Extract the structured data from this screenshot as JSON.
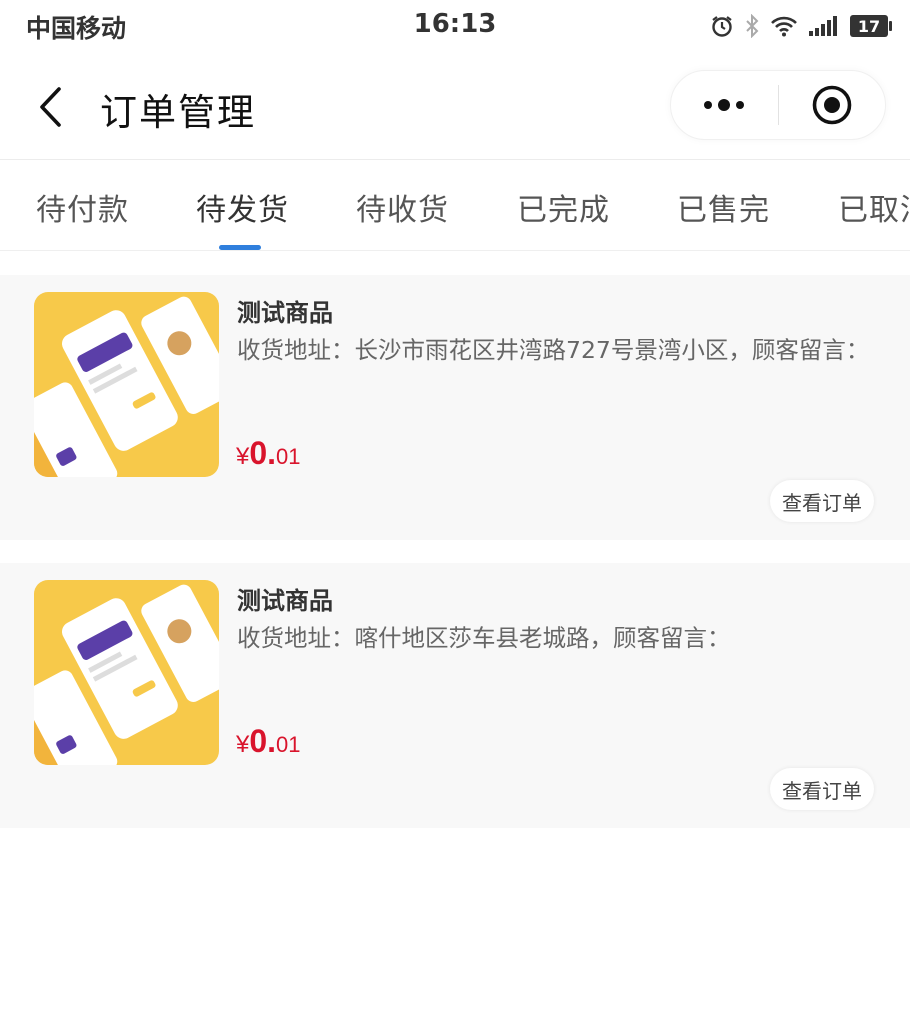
{
  "status_bar": {
    "carrier": "中国移动",
    "time": "16:13",
    "battery": "17"
  },
  "nav": {
    "title": "订单管理"
  },
  "tabs": [
    {
      "label": "待付款",
      "active": false
    },
    {
      "label": "待发货",
      "active": true
    },
    {
      "label": "待收货",
      "active": false
    },
    {
      "label": "已完成",
      "active": false
    },
    {
      "label": "已售完",
      "active": false
    },
    {
      "label": "已取消",
      "active": false
    }
  ],
  "orders": [
    {
      "name": "测试商品",
      "address": "收货地址：长沙市雨花区井湾路727号景湾小区，顾客留言：",
      "price_symbol": "¥",
      "price_int": "0.",
      "price_dec": "01",
      "view_label": "查看订单"
    },
    {
      "name": "测试商品",
      "address": "收货地址：喀什地区莎车县老城路，顾客留言：",
      "price_symbol": "¥",
      "price_int": "0.",
      "price_dec": "01",
      "view_label": "查看订单"
    }
  ],
  "colors": {
    "accent": "#2f7fdd",
    "price": "#d9142c",
    "card_bg": "#f8f8f8",
    "thumb_yellow": "#f7c94a"
  }
}
